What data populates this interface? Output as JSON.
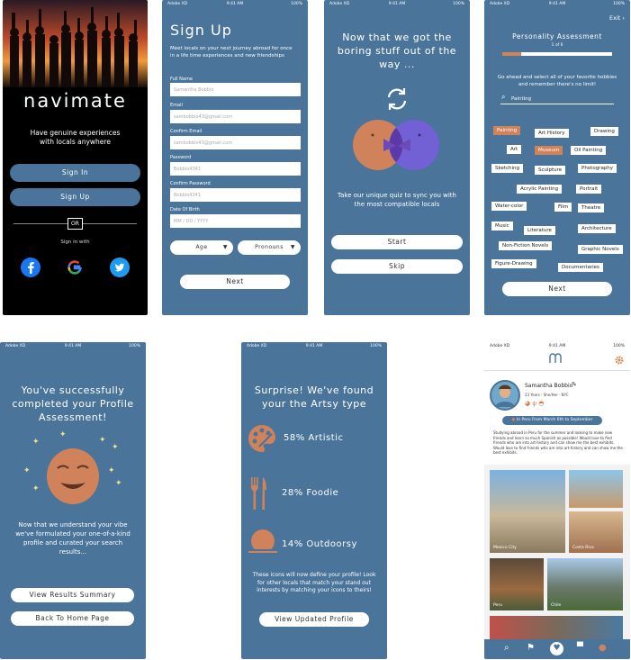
{
  "status": {
    "carrier": "Adobe XD",
    "time": "9:41 AM",
    "battery": "100%"
  },
  "screen1": {
    "logo": "navimate",
    "tagline": "Have genuine experiences with locals anywhere",
    "signin_label": "Sign In",
    "signup_label": "Sign Up",
    "or_label": "OR",
    "signin_with": "Sign in with"
  },
  "screen2": {
    "title": "Sign Up",
    "subtitle": "Meet locals on your next journey abroad for once in a life time experiences and new friendships",
    "fields": [
      {
        "label": "Full Name",
        "value": "Samantha Bobbio"
      },
      {
        "label": "Email",
        "value": "sambobbio43@gmail.com"
      },
      {
        "label": "Confirm Email",
        "value": "sambobbio43@gmail.com"
      },
      {
        "label": "Password",
        "value": "Bobbio4341"
      },
      {
        "label": "Confirm Password",
        "value": "Bobbio4341"
      },
      {
        "label": "Date Of Birth",
        "value": "MM / DD / YYYY"
      }
    ],
    "age_label": "Age",
    "pronouns_label": "Pronouns",
    "next_label": "Next"
  },
  "screen3": {
    "title": "Now that we got the boring stuff out of the way ...",
    "body": "Take our unique quiz to sync you with the most compatible locals",
    "start_label": "Start",
    "skip_label": "Skip"
  },
  "screen4": {
    "exit_label": "Exit",
    "title": "Personality Assessment",
    "step": "1 of 6",
    "instructions": "Go ahead and select all of your favorite hobbies and remember there's no limit!",
    "search_value": "Painting",
    "tags": [
      "Painting",
      "Art History",
      "Drawing",
      "Art",
      "Museum",
      "Oil Painting",
      "Sketching",
      "Sculpture",
      "Photography",
      "Acrylic Painting",
      "Portrait",
      "Water-color",
      "Film",
      "Theatre",
      "Music",
      "Literature",
      "Architecture",
      "Non-Fiction Novels",
      "Graphic Novels",
      "Figure-Drawing",
      "Documentaries"
    ],
    "progress": 0.17,
    "next_label": "Next"
  },
  "screen5": {
    "title": "You've successfully completed your Profile Assessment!",
    "body": "Now that we understand your vibe we've formulated your one-of-a-kind profile and curated your search results...",
    "results_label": "View Results Summary",
    "home_label": "Back To Home Page"
  },
  "screen6": {
    "title": "Surprise! We've found your the Artsy type",
    "stats": [
      {
        "label": "58% Artistic"
      },
      {
        "label": "28% Foodie"
      },
      {
        "label": "14% Outdoorsy"
      }
    ],
    "body": "These icons will now define your profile! Look for other locals that match your stand out interests by matching your icons to theirs!",
    "profile_label": "View Updated Profile"
  },
  "screen7": {
    "name": "Samantha Bobbio",
    "meta": "23 Years · She/Her · NYC",
    "trip": "In Peru From March 6th to September",
    "bio": "Studying abroad in Peru for the summer and looking to make new friends and learn so much Spanish as possible! Would love to find friends who are into art-history and can show me the best exhibits. Would love to find friends who are into art-history and can show me the best exhibits.",
    "photo_captions": [
      "Mexico City",
      "Costa Rica",
      "Peru",
      "Chile"
    ]
  },
  "colors": {
    "primary": "#4a7499",
    "accent": "#d0825a",
    "sparkle": "#f1e18c"
  }
}
